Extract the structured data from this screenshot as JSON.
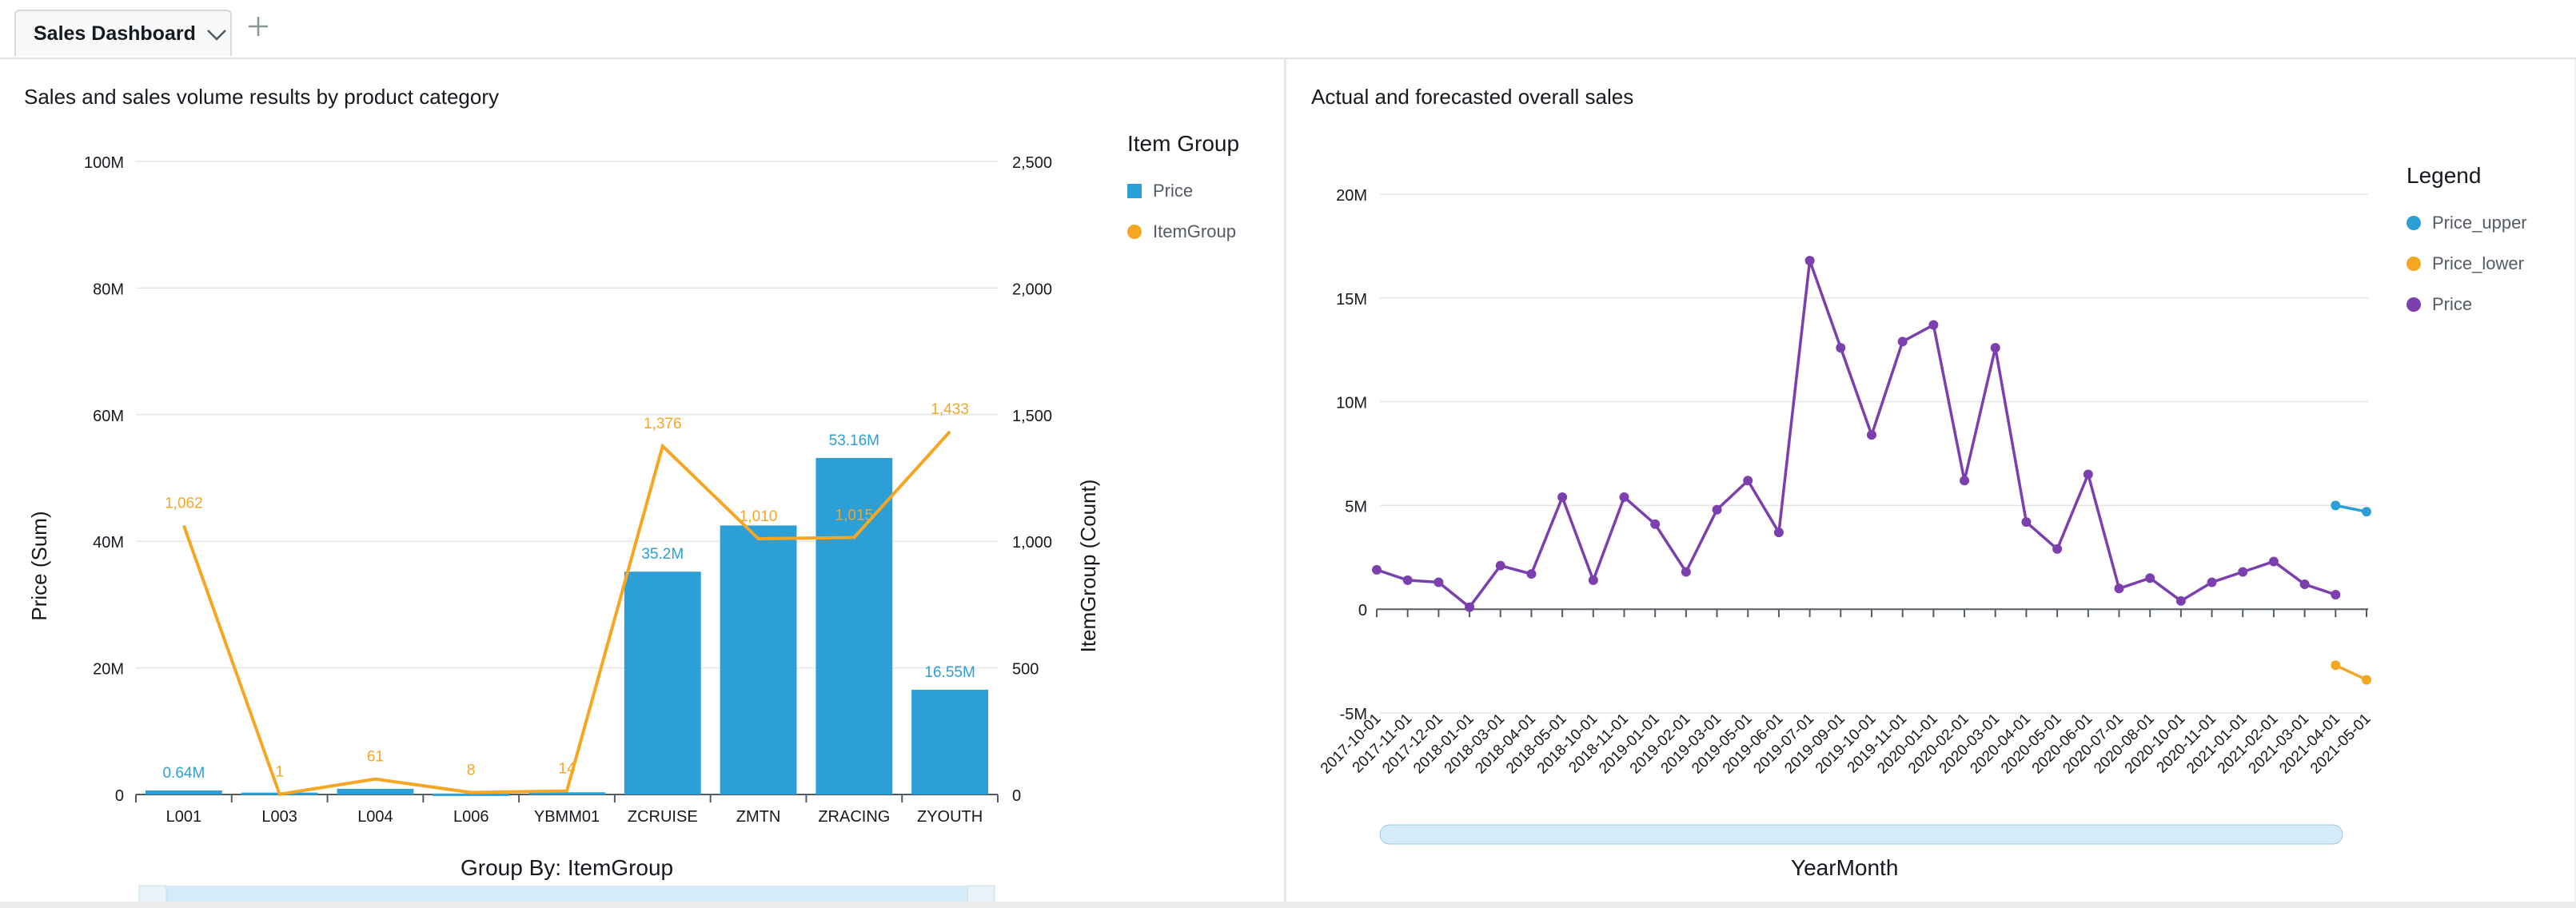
{
  "tabs": [
    {
      "label": "Sales Dashboard"
    }
  ],
  "icons": {
    "tab_menu": "chevron-down-icon",
    "add_tab": "plus-icon"
  },
  "colors": {
    "price": "#2b9fd6",
    "item_group": "#f5a623",
    "price_line": "#7b3fae",
    "price_upper": "#2b9fd6",
    "price_lower": "#f5a623",
    "grid": "#e6e6e6"
  },
  "left_visual": {
    "title": "Sales and sales volume results by product category",
    "legend_title": "Item Group",
    "legend": [
      "Price",
      "ItemGroup"
    ],
    "y_left_label": "Price (Sum)",
    "y_right_label": "ItemGroup (Count)",
    "x_label": "Group By: ItemGroup"
  },
  "right_visual": {
    "title": "Actual and forecasted overall sales",
    "legend_title": "Legend",
    "legend": [
      "Price_upper",
      "Price_lower",
      "Price"
    ],
    "x_label": "YearMonth"
  },
  "chart_data": [
    {
      "type": "bar",
      "title": "Sales and sales volume results by product category",
      "xlabel": "Group By: ItemGroup",
      "ylabel": "Price (Sum)",
      "y2label": "ItemGroup (Count)",
      "categories": [
        "L001",
        "L003",
        "L004",
        "L006",
        "YBMM01",
        "ZCRUISE",
        "ZMTN",
        "ZRACING",
        "ZYOUTH"
      ],
      "series": [
        {
          "name": "Price",
          "type": "bar",
          "axis": "left",
          "values": [
            640000,
            300000,
            900000,
            150000,
            350000,
            35200000,
            42500000,
            53160000,
            16550000
          ],
          "labels": [
            "0.64M",
            "",
            "",
            "",
            "",
            "35.2M",
            "",
            "53.16M",
            "16.55M"
          ]
        },
        {
          "name": "ItemGroup",
          "type": "line",
          "axis": "right",
          "values": [
            1062,
            1,
            61,
            8,
            14,
            1376,
            1010,
            1015,
            1433
          ],
          "labels": [
            "1,062",
            "1",
            "61",
            "8",
            "14",
            "1,376",
            "1,010",
            "1,015",
            "1,433"
          ]
        }
      ],
      "ylim": [
        0,
        100000000
      ],
      "y2lim": [
        0,
        2500
      ],
      "yticks": [
        "0",
        "20M",
        "40M",
        "60M",
        "80M",
        "100M"
      ],
      "y2ticks": [
        "0",
        "500",
        "1,000",
        "1,500",
        "2,000",
        "2,500"
      ],
      "legend": "right",
      "grid": true
    },
    {
      "type": "line",
      "title": "Actual and forecasted overall sales",
      "xlabel": "YearMonth",
      "ylabel": "",
      "x": [
        "2017-10-01",
        "2017-11-01",
        "2017-12-01",
        "2018-01-01",
        "2018-03-01",
        "2018-04-01",
        "2018-05-01",
        "2018-10-01",
        "2018-11-01",
        "2019-01-01",
        "2019-02-01",
        "2019-03-01",
        "2019-05-01",
        "2019-06-01",
        "2019-07-01",
        "2019-09-01",
        "2019-10-01",
        "2019-11-01",
        "2020-01-01",
        "2020-02-01",
        "2020-03-01",
        "2020-04-01",
        "2020-05-01",
        "2020-06-01",
        "2020-07-01",
        "2020-08-01",
        "2020-10-01",
        "2020-11-01",
        "2021-01-01",
        "2021-02-01",
        "2021-03-01",
        "2021-04-01",
        "2021-05-01"
      ],
      "series": [
        {
          "name": "Price",
          "values": [
            1900000,
            1400000,
            1300000,
            100000,
            2100000,
            1700000,
            5400000,
            1400000,
            5400000,
            4100000,
            1800000,
            4800000,
            6200000,
            3700000,
            16800000,
            12600000,
            8400000,
            12900000,
            13700000,
            6200000,
            12600000,
            4200000,
            2900000,
            6500000,
            1000000,
            1500000,
            400000,
            1300000,
            1800000,
            2300000,
            1200000,
            700000
          ]
        },
        {
          "name": "Price_upper",
          "values": [
            null,
            null,
            null,
            null,
            null,
            null,
            null,
            null,
            null,
            null,
            null,
            null,
            null,
            null,
            null,
            null,
            null,
            null,
            null,
            null,
            null,
            null,
            null,
            null,
            null,
            null,
            null,
            null,
            null,
            null,
            null,
            5000000,
            4700000
          ]
        },
        {
          "name": "Price_lower",
          "values": [
            null,
            null,
            null,
            null,
            null,
            null,
            null,
            null,
            null,
            null,
            null,
            null,
            null,
            null,
            null,
            null,
            null,
            null,
            null,
            null,
            null,
            null,
            null,
            null,
            null,
            null,
            null,
            null,
            null,
            null,
            null,
            -2700000,
            -3400000
          ]
        }
      ],
      "ylim": [
        -5000000,
        20000000
      ],
      "yticks": [
        "-5M",
        "0",
        "5M",
        "10M",
        "15M",
        "20M"
      ],
      "legend": "right",
      "grid": true
    }
  ]
}
